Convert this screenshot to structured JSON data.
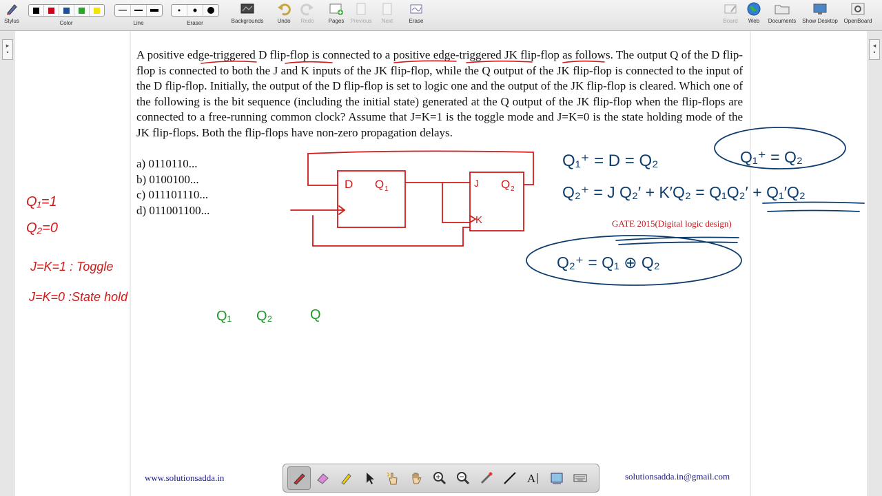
{
  "toolbar": {
    "stylus": "Stylus",
    "color": "Color",
    "line": "Line",
    "eraser": "Eraser",
    "backgrounds": "Backgrounds",
    "undo": "Undo",
    "redo": "Redo",
    "pages": "Pages",
    "previous": "Previous",
    "next": "Next",
    "erase": "Erase",
    "board": "Board",
    "web": "Web",
    "documents": "Documents",
    "show_desktop": "Show Desktop",
    "openboard": "OpenBoard",
    "colors": [
      "#000000",
      "#d0021b",
      "#1f4e9a",
      "#2aa52a",
      "#f2e600"
    ]
  },
  "page": {
    "question": "A positive edge-triggered D flip-flop is connected to a positive edge-triggered JK flip-flop as follows. The output Q of the D flip-flop is connected to both the J and K inputs of the JK flip-flop, while the Q output of the JK flip-flop is connected to the input of the D flip-flop. Initially, the output of the D flip-flop is set to logic one and the output of the JK flip-flop is cleared. Which one of the following is the bit sequence (including the initial state) generated at the Q output of the JK flip-flop when the flip-flops are connected to a free-running common clock? Assume that J=K=1 is the toggle mode and J=K=0 is the state holding mode of the JK flip-flops. Both the flip-flops have non-zero propagation delays.",
    "options": [
      "a) 0110110...",
      "b) 0100100...",
      "c) 011101110...",
      "d) 011001100..."
    ],
    "source_note": "GATE 2015(Digital logic design)",
    "footer_left": "www.solutionsadda.in",
    "footer_right": "solutionsadda.in@gmail.com"
  },
  "ink_colors": {
    "red": "#d11a1a",
    "blue": "#0d3c6e",
    "green": "#1d9a2a"
  }
}
